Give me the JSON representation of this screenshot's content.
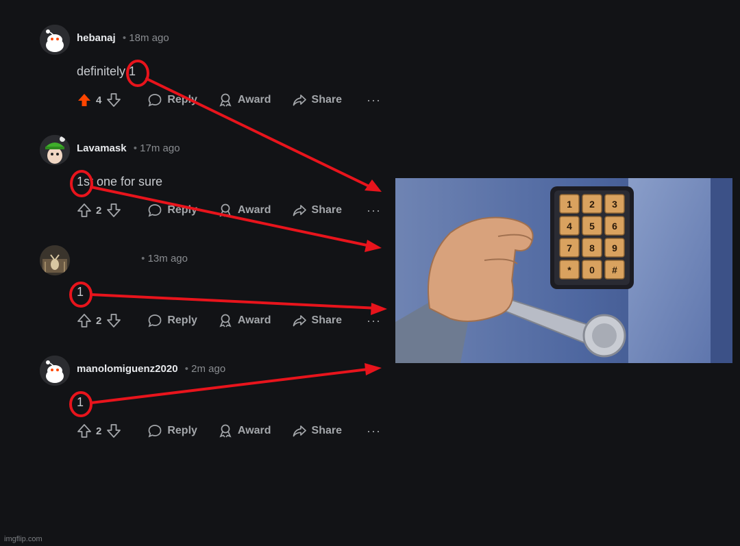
{
  "comments": [
    {
      "username": "hebanaj",
      "time": "18m ago",
      "text": "definitely 1",
      "votes": "4",
      "upvoted": true,
      "reply": "Reply",
      "award": "Award",
      "share": "Share",
      "more": "···",
      "avatar_icon": "reddit-snoo-avatar-icon"
    },
    {
      "username": "Lavamask",
      "time": "17m ago",
      "text": "1st one for sure",
      "votes": "2",
      "upvoted": false,
      "reply": "Reply",
      "award": "Award",
      "share": "Share",
      "more": "···",
      "avatar_icon": "green-hat-avatar-icon"
    },
    {
      "username": "",
      "time": "13m ago",
      "text": "1",
      "votes": "2",
      "upvoted": false,
      "reply": "Reply",
      "award": "Award",
      "share": "Share",
      "more": "···",
      "avatar_icon": "deer-avatar-icon"
    },
    {
      "username": "manolomiguenz2020",
      "time": "2m ago",
      "text": "1",
      "votes": "2",
      "upvoted": false,
      "reply": "Reply",
      "award": "Award",
      "share": "Share",
      "more": "···",
      "avatar_icon": "reddit-snoo-avatar-icon"
    }
  ],
  "keypad": {
    "keys": [
      "1",
      "2",
      "3",
      "4",
      "5",
      "6",
      "7",
      "8",
      "9",
      "*",
      "0",
      "#"
    ]
  },
  "watermark": "imgflip.com",
  "colors": {
    "background": "#121316",
    "upvote": "#ff4500",
    "annotation": "#e8141c",
    "keypad_key": "#d9a25f"
  }
}
